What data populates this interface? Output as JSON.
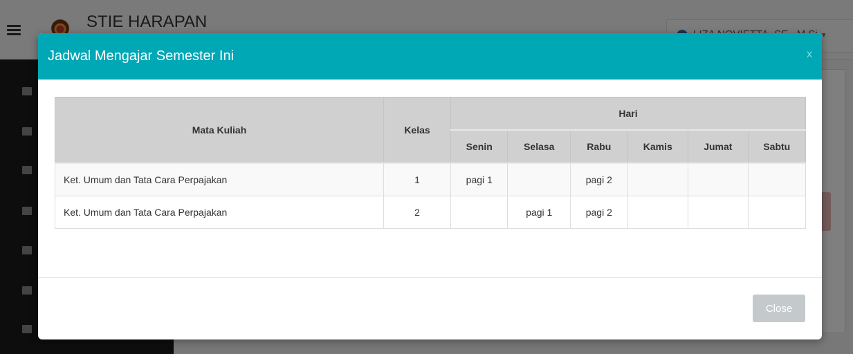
{
  "app": {
    "title": "STIE HARAPAN",
    "user_name": "LIZA NOVIETTA, SE., M.Si"
  },
  "sidebar": {
    "icons": [
      "home-icon",
      "book-icon",
      "edit-icon",
      "calendar-icon",
      "file-icon",
      "table-icon",
      "calendar-icon"
    ]
  },
  "modal": {
    "title": "Jadwal Mengajar Semester Ini",
    "close_x": "x",
    "close_button": "Close"
  },
  "table": {
    "headers": {
      "course": "Mata Kuliah",
      "class": "Kelas",
      "day_group": "Hari",
      "days": [
        "Senin",
        "Selasa",
        "Rabu",
        "Kamis",
        "Jumat",
        "Sabtu"
      ]
    },
    "rows": [
      {
        "course": "Ket. Umum dan Tata Cara Perpajakan",
        "class": "1",
        "days": [
          "pagi 1",
          "",
          "pagi 2",
          "",
          "",
          ""
        ]
      },
      {
        "course": "Ket. Umum dan Tata Cara Perpajakan",
        "class": "2",
        "days": [
          "",
          "pagi 1",
          "pagi 2",
          "",
          "",
          ""
        ]
      }
    ]
  },
  "colors": {
    "modal_header": "#00a7b5",
    "sidebar": "#1a1a1a",
    "close_button": "#c4c9cc"
  }
}
